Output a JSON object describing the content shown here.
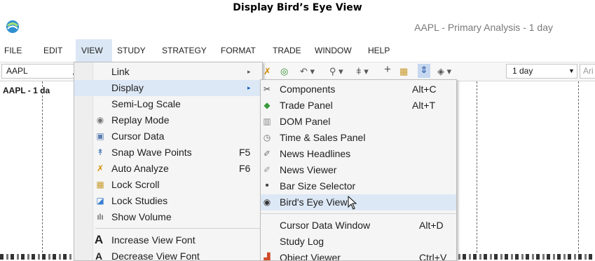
{
  "caption": "Display Bird’s Eye View",
  "window": {
    "title": "AAPL - Primary Analysis - 1 day"
  },
  "menubar": [
    "FILE",
    "EDIT",
    "VIEW",
    "STUDY",
    "STRATEGY",
    "FORMAT",
    "TRADE",
    "WINDOW",
    "HELP"
  ],
  "toolbar": {
    "symbol": "AAPL",
    "period": "1 day",
    "font": "Ari"
  },
  "chart": {
    "label": "AAPL - 1 da"
  },
  "view_menu": {
    "items": [
      {
        "label": "Link",
        "arrow": "▸"
      },
      {
        "label": "Display",
        "arrow": "▸"
      },
      {
        "label": "Semi-Log Scale"
      },
      {
        "label": "Replay Mode",
        "icon": "replay-icon"
      },
      {
        "label": "Cursor Data",
        "icon": "cursor-data-icon"
      },
      {
        "label": "Snap Wave Points",
        "shortcut": "F5",
        "icon": "snap-wave-icon"
      },
      {
        "label": "Auto Analyze",
        "shortcut": "F6",
        "icon": "auto-analyze-icon"
      },
      {
        "label": "Lock Scroll",
        "icon": "lock-scroll-icon"
      },
      {
        "label": "Lock Studies",
        "icon": "lock-studies-icon"
      },
      {
        "label": "Show Volume",
        "icon": "volume-icon"
      },
      {
        "label": "Increase View Font",
        "icon": "increase-font-icon"
      },
      {
        "label": "Decrease View Font",
        "icon": "decrease-font-icon"
      }
    ]
  },
  "display_menu": {
    "items": [
      {
        "label": "Components",
        "shortcut": "Alt+C",
        "icon": "tools-icon"
      },
      {
        "label": "Trade Panel",
        "shortcut": "Alt+T",
        "icon": "trade-panel-icon"
      },
      {
        "label": "DOM Panel",
        "icon": "dom-panel-icon"
      },
      {
        "label": "Time & Sales Panel",
        "icon": "clock-icon"
      },
      {
        "label": "News Headlines",
        "icon": "news-icon"
      },
      {
        "label": "News Viewer",
        "icon": "news-viewer-icon"
      },
      {
        "label": "Bar Size Selector",
        "bullet": "•"
      },
      {
        "label": "Bird's Eye View",
        "icon": "eye-icon"
      },
      {
        "label": "Cursor Data Window",
        "shortcut": "Alt+D"
      },
      {
        "label": "Study Log"
      },
      {
        "label": "Object Viewer",
        "shortcut": "Ctrl+V",
        "icon": "object-viewer-icon"
      }
    ]
  },
  "colors": {
    "highlight": "#dde8f6",
    "menu_bg": "#f5f5f5",
    "title_text": "#7a7a7a"
  }
}
